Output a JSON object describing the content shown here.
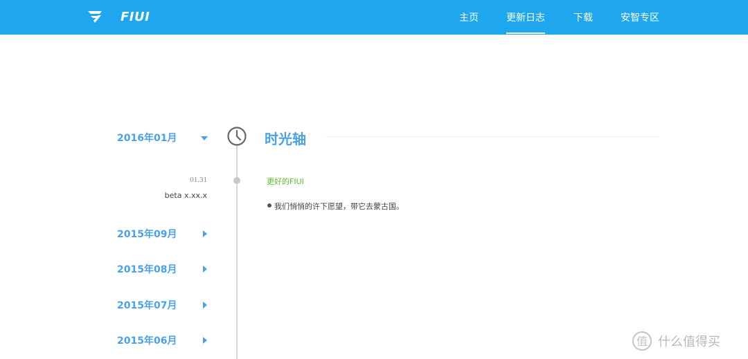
{
  "header": {
    "brand": "FIUI",
    "background": "#1ea7ee",
    "nav": [
      {
        "label": "主页",
        "active": false
      },
      {
        "label": "更新日志",
        "active": true
      },
      {
        "label": "下载",
        "active": false
      },
      {
        "label": "安智专区",
        "active": false
      }
    ]
  },
  "timeline": {
    "title": "时光轴",
    "accent": "#4ba1e6",
    "months": [
      {
        "label": "2016年01月",
        "expanded": true
      },
      {
        "label": "2015年09月",
        "expanded": false
      },
      {
        "label": "2015年08月",
        "expanded": false
      },
      {
        "label": "2015年07月",
        "expanded": false
      },
      {
        "label": "2015年06月",
        "expanded": false
      }
    ],
    "entry": {
      "date": "01.31",
      "version": "beta x.xx.x",
      "title": "更好的FIUI",
      "title_color": "#5cc02e",
      "items": [
        "我们悄悄的许下愿望，带它去蒙古国。"
      ]
    }
  },
  "watermark": {
    "icon": "value-buy-icon",
    "text": "什么值得买"
  }
}
